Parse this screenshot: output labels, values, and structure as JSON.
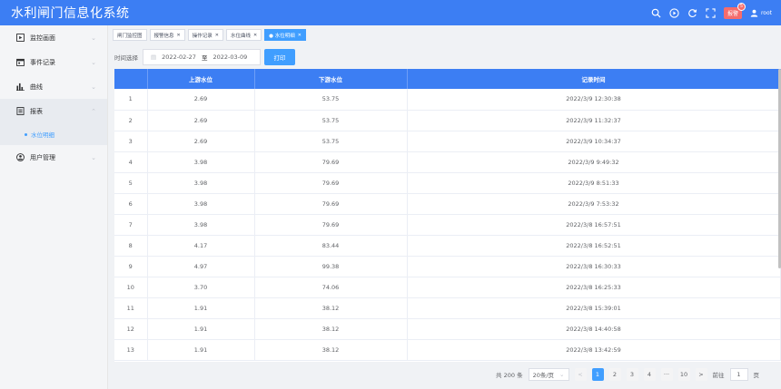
{
  "app": {
    "title": "水利闸门信息化系统"
  },
  "topbar": {
    "alarm_label": "报警",
    "alarm_count": "5",
    "username": "root"
  },
  "sidebar": {
    "items": [
      {
        "label": "监控画面",
        "icon": "monitor-icon"
      },
      {
        "label": "事件记录",
        "icon": "calendar-icon"
      },
      {
        "label": "曲线",
        "icon": "bar-chart-icon"
      },
      {
        "label": "报表",
        "icon": "report-icon",
        "sub": "水位明细"
      },
      {
        "label": "用户管理",
        "icon": "user-icon"
      }
    ]
  },
  "tabs": [
    {
      "label": "闸门监控图",
      "closable": false
    },
    {
      "label": "报警信息",
      "closable": true
    },
    {
      "label": "操作记录",
      "closable": true
    },
    {
      "label": "水位曲线",
      "closable": true
    },
    {
      "label": "● 水位明细",
      "closable": true,
      "active": true
    }
  ],
  "filter": {
    "label": "时间选择",
    "start": "2022-02-27",
    "sep": "至",
    "end": "2022-03-09",
    "print_label": "打印"
  },
  "table": {
    "headers": [
      "",
      "上游水位",
      "下游水位",
      "记录时间"
    ],
    "rows": [
      [
        "1",
        "2.69",
        "53.75",
        "2022/3/9 12:30:38"
      ],
      [
        "2",
        "2.69",
        "53.75",
        "2022/3/9 11:32:37"
      ],
      [
        "3",
        "2.69",
        "53.75",
        "2022/3/9 10:34:37"
      ],
      [
        "4",
        "3.98",
        "79.69",
        "2022/3/9 9:49:32"
      ],
      [
        "5",
        "3.98",
        "79.69",
        "2022/3/9 8:51:33"
      ],
      [
        "6",
        "3.98",
        "79.69",
        "2022/3/9 7:53:32"
      ],
      [
        "7",
        "3.98",
        "79.69",
        "2022/3/8 16:57:51"
      ],
      [
        "8",
        "4.17",
        "83.44",
        "2022/3/8 16:52:51"
      ],
      [
        "9",
        "4.97",
        "99.38",
        "2022/3/8 16:30:33"
      ],
      [
        "10",
        "3.70",
        "74.06",
        "2022/3/8 16:25:33"
      ],
      [
        "11",
        "1.91",
        "38.12",
        "2022/3/8 15:39:01"
      ],
      [
        "12",
        "1.91",
        "38.12",
        "2022/3/8 14:40:58"
      ],
      [
        "13",
        "1.91",
        "38.12",
        "2022/3/8 13:42:59"
      ]
    ]
  },
  "pagination": {
    "total": "共 200 条",
    "page_size": "20条/页",
    "prev": "<",
    "pages": [
      "1",
      "2",
      "3",
      "4",
      "···",
      "10"
    ],
    "current": "1",
    "next": ">",
    "goto_label": "前往",
    "goto_value": "1",
    "goto_unit": "页"
  }
}
